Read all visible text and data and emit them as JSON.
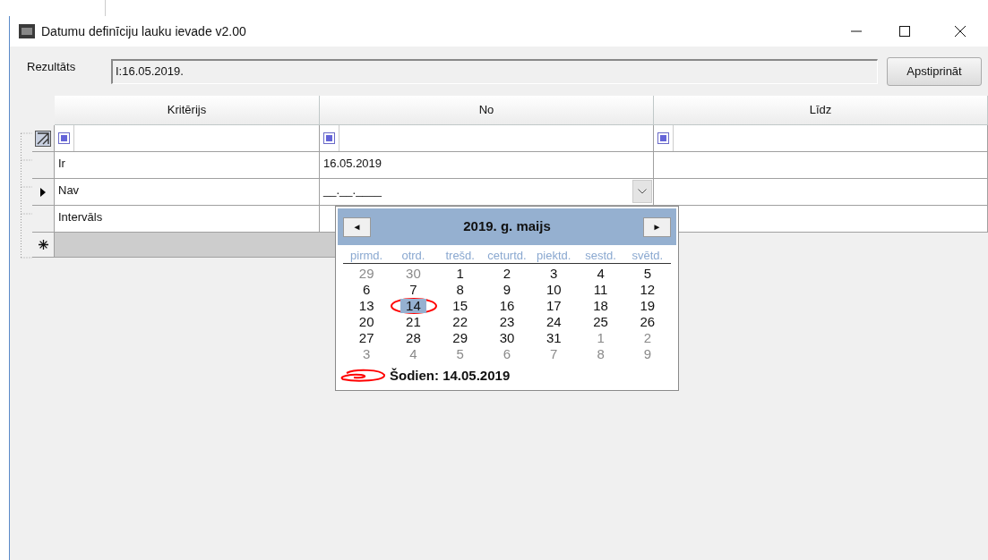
{
  "window": {
    "title": "Datumu definīciju lauku ievade v2.00"
  },
  "result": {
    "label": "Rezultāts",
    "value": "I:16.05.2019.",
    "button": "Apstiprināt"
  },
  "grid": {
    "columns": [
      "Kritērijs",
      "No",
      "Līdz"
    ],
    "rows": [
      {
        "kind": "filter",
        "current": false,
        "cells": [
          "",
          "",
          ""
        ]
      },
      {
        "kind": "data",
        "current": false,
        "cells": [
          "Ir",
          "16.05.2019",
          ""
        ]
      },
      {
        "kind": "edit",
        "current": true,
        "cells": [
          "Nav",
          "__.__.____",
          ""
        ]
      },
      {
        "kind": "data",
        "current": false,
        "cells": [
          "Intervāls",
          "",
          ""
        ]
      },
      {
        "kind": "new",
        "current": false,
        "cells": []
      }
    ]
  },
  "calendar": {
    "title": "2019. g. maijs",
    "prev": "◄",
    "next": "►",
    "weekdays": [
      "pirmd.",
      "otrd.",
      "trešd.",
      "ceturtd.",
      "piektd.",
      "sestd.",
      "svētd."
    ],
    "days": [
      {
        "day": "29",
        "kind": "other",
        "selected": false
      },
      {
        "day": "30",
        "kind": "other",
        "selected": false
      },
      {
        "day": "1",
        "kind": "month",
        "selected": false
      },
      {
        "day": "2",
        "kind": "month",
        "selected": false
      },
      {
        "day": "3",
        "kind": "month",
        "selected": false
      },
      {
        "day": "4",
        "kind": "month",
        "selected": false
      },
      {
        "day": "5",
        "kind": "month",
        "selected": false
      },
      {
        "day": "6",
        "kind": "month",
        "selected": false
      },
      {
        "day": "7",
        "kind": "month",
        "selected": false
      },
      {
        "day": "8",
        "kind": "month",
        "selected": false
      },
      {
        "day": "9",
        "kind": "month",
        "selected": false
      },
      {
        "day": "10",
        "kind": "month",
        "selected": false
      },
      {
        "day": "11",
        "kind": "month",
        "selected": false
      },
      {
        "day": "12",
        "kind": "month",
        "selected": false
      },
      {
        "day": "13",
        "kind": "month",
        "selected": false
      },
      {
        "day": "14",
        "kind": "month",
        "selected": true
      },
      {
        "day": "15",
        "kind": "month",
        "selected": false
      },
      {
        "day": "16",
        "kind": "month",
        "selected": false
      },
      {
        "day": "17",
        "kind": "month",
        "selected": false
      },
      {
        "day": "18",
        "kind": "month",
        "selected": false
      },
      {
        "day": "19",
        "kind": "month",
        "selected": false
      },
      {
        "day": "20",
        "kind": "month",
        "selected": false
      },
      {
        "day": "21",
        "kind": "month",
        "selected": false
      },
      {
        "day": "22",
        "kind": "month",
        "selected": false
      },
      {
        "day": "23",
        "kind": "month",
        "selected": false
      },
      {
        "day": "24",
        "kind": "month",
        "selected": false
      },
      {
        "day": "25",
        "kind": "month",
        "selected": false
      },
      {
        "day": "26",
        "kind": "month",
        "selected": false
      },
      {
        "day": "27",
        "kind": "month",
        "selected": false
      },
      {
        "day": "28",
        "kind": "month",
        "selected": false
      },
      {
        "day": "29",
        "kind": "month",
        "selected": false
      },
      {
        "day": "30",
        "kind": "month",
        "selected": false
      },
      {
        "day": "31",
        "kind": "month",
        "selected": false
      },
      {
        "day": "1",
        "kind": "other",
        "selected": false
      },
      {
        "day": "2",
        "kind": "other",
        "selected": false
      },
      {
        "day": "3",
        "kind": "other",
        "selected": false
      },
      {
        "day": "4",
        "kind": "other",
        "selected": false
      },
      {
        "day": "5",
        "kind": "other",
        "selected": false
      },
      {
        "day": "6",
        "kind": "other",
        "selected": false
      },
      {
        "day": "7",
        "kind": "other",
        "selected": false
      },
      {
        "day": "8",
        "kind": "other",
        "selected": false
      },
      {
        "day": "9",
        "kind": "other",
        "selected": false
      }
    ],
    "today": "Šodien: 14.05.2019"
  }
}
